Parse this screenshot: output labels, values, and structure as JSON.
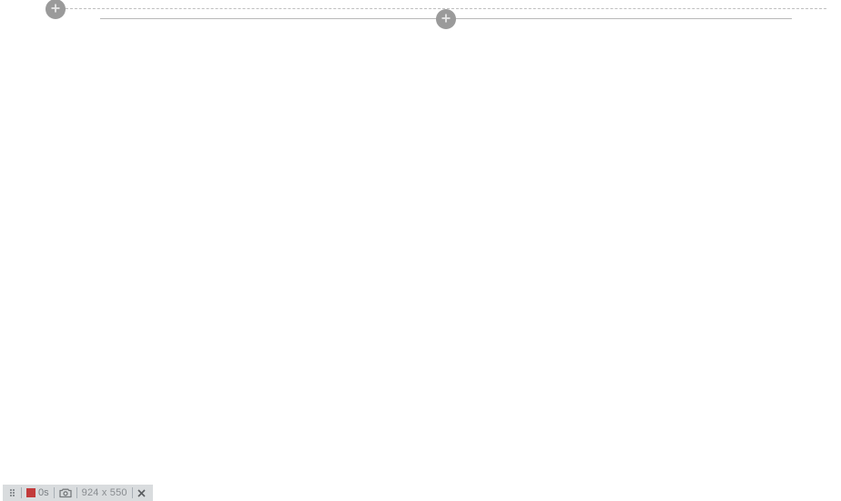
{
  "toolbar": {
    "timer": "0s",
    "dimensions": "924 x 550"
  },
  "colors": {
    "record": "#c23b3b",
    "addButton": "#9a9a9a",
    "toolbarBg": "#d9dcde"
  }
}
